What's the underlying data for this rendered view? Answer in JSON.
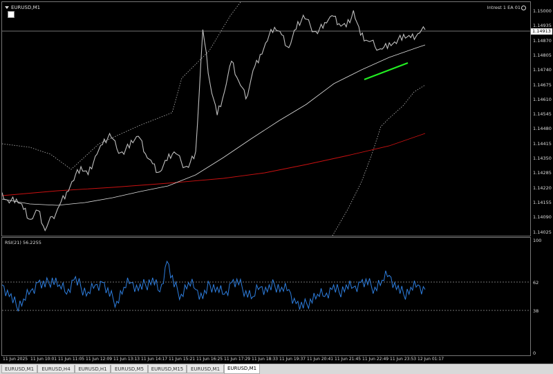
{
  "chart": {
    "symbol_label": "EURUSD,M1",
    "ea_label": "Intrest 1 EA 01",
    "current_price": "1.14913",
    "rsi_label": "RSI(21) 56.2255"
  },
  "price_axis": [
    "1.15000",
    "1.14935",
    "1.14870",
    "1.14805",
    "1.14740",
    "1.14675",
    "1.14610",
    "1.14545",
    "1.14480",
    "1.14415",
    "1.14350",
    "1.14285",
    "1.14220",
    "1.14155",
    "1.14090",
    "1.14025"
  ],
  "rsi_axis": [
    "100",
    "62",
    "38",
    "0"
  ],
  "time_axis": [
    "11 Jun 2025",
    "11 Jun 10:01",
    "11 Jun 11:05",
    "11 Jun 12:09",
    "11 Jun 13:13",
    "11 Jun 14:17",
    "11 Jun 15:21",
    "11 Jun 16:25",
    "11 Jun 17:29",
    "11 Jun 18:33",
    "11 Jun 19:37",
    "11 Jun 20:41",
    "11 Jun 21:45",
    "11 Jun 22:49",
    "11 Jun 23:53",
    "12 Jun 01:17"
  ],
  "tabs": [
    "EURUSD,M1",
    "EURUSD,H4",
    "EURUSD,H1",
    "EURUSD,M5",
    "EURUSD,M15",
    "EURUSD,M1",
    "EURUSD,M1"
  ],
  "active_tab": 6,
  "colors": {
    "background": "#000000",
    "price": "#c0c0c0",
    "ma_fast": "#e0e0e0",
    "ma_slow": "#cc1111",
    "signal": "#22ee22",
    "rsi": "#2e7fe0",
    "grid": "#999999"
  },
  "chart_data": {
    "type": "line",
    "series": [
      {
        "values": [
          1.142,
          1.1416,
          1.1418,
          1.1414,
          1.1409,
          1.1413,
          1.1405,
          1.141,
          1.1415,
          1.1421,
          1.1426,
          1.1431,
          1.1428,
          1.1436,
          1.144,
          1.1445,
          1.1439,
          1.1437,
          1.1442,
          1.1444,
          1.1437,
          1.1432,
          1.1429,
          1.1434,
          1.1438,
          1.1433,
          1.1431,
          1.1438,
          1.1488,
          1.1466,
          1.1453,
          1.1463,
          1.1475,
          1.1467,
          1.146,
          1.1471,
          1.1478,
          1.1484,
          1.149,
          1.1486,
          1.1481,
          1.1489,
          1.1494,
          1.149,
          1.1487,
          1.1492,
          1.1494,
          1.1491,
          1.149,
          1.1496,
          1.1486,
          1.1484,
          1.1482,
          1.148,
          1.1483,
          1.1483,
          1.1486,
          1.1485,
          1.1487,
          1.1489
        ]
      },
      {
        "name": "RSI(21)",
        "values": [
          60,
          50,
          42,
          48,
          55,
          62,
          58,
          66,
          60,
          52,
          64,
          58,
          54,
          60,
          62,
          50,
          46,
          58,
          62,
          55,
          60,
          66,
          54,
          80,
          58,
          52,
          62,
          56,
          48,
          60,
          58,
          52,
          62,
          60,
          55,
          50,
          58,
          54,
          60,
          58,
          56,
          44,
          40,
          48,
          52,
          50,
          56,
          54,
          60,
          58,
          62,
          60,
          58,
          64,
          68,
          56,
          52,
          58,
          60,
          56
        ]
      }
    ],
    "ylim": [
      1.14025,
      1.15
    ],
    "rsi_levels": [
      62,
      38
    ],
    "rsi_range": [
      0,
      100
    ]
  }
}
